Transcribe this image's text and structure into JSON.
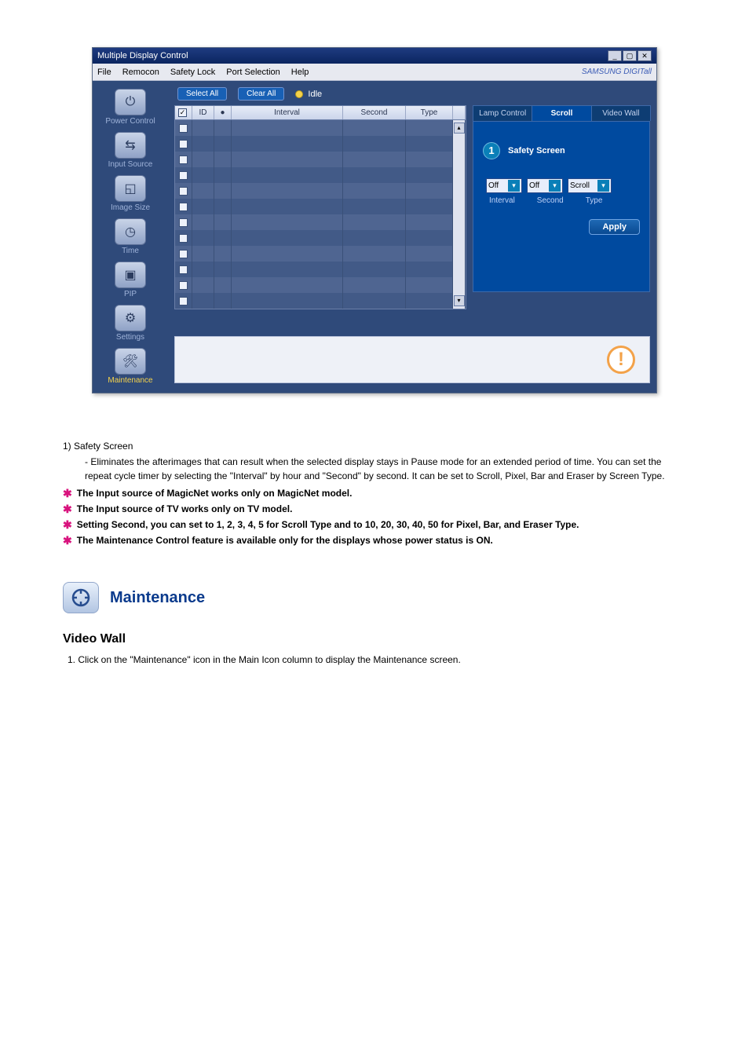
{
  "window": {
    "title": "Multiple Display Control",
    "menus": [
      "File",
      "Remocon",
      "Safety Lock",
      "Port Selection",
      "Help"
    ],
    "branding": "SAMSUNG DIGITall"
  },
  "sidebar": {
    "items": [
      {
        "label": "Power Control"
      },
      {
        "label": "Input Source"
      },
      {
        "label": "Image Size"
      },
      {
        "label": "Time"
      },
      {
        "label": "PIP"
      },
      {
        "label": "Settings"
      },
      {
        "label": "Maintenance"
      }
    ]
  },
  "toolbar": {
    "select_all": "Select All",
    "clear_all": "Clear All",
    "idle": "Idle"
  },
  "table": {
    "headers": {
      "chk": "",
      "id": "ID",
      "l": "",
      "interval": "Interval",
      "second": "Second",
      "type": "Type"
    },
    "row_count": 12
  },
  "rpanel": {
    "tabs": [
      {
        "label": "Lamp Control",
        "active": false
      },
      {
        "label": "Scroll",
        "active": true
      },
      {
        "label": "Video Wall",
        "active": false
      }
    ],
    "badge": "1",
    "section_title": "Safety Screen",
    "dd_interval": "Off",
    "dd_second": "Off",
    "dd_type": "Scroll",
    "lbl_interval": "Interval",
    "lbl_second": "Second",
    "lbl_type": "Type",
    "apply": "Apply"
  },
  "doc": {
    "point1_title": "1)  Safety Screen",
    "point1_sub": "- Eliminates the afterimages that can result when the selected display stays in Pause mode for an extended period of time. You can set the repeat cycle timer by selecting the \"Interval\" by hour and \"Second\" by second. It can be set to Scroll, Pixel, Bar and Eraser by Screen Type.",
    "stars": [
      "The Input source of MagicNet works only on MagicNet model.",
      "The Input source of TV works only on TV model.",
      "Setting Second, you can set to 1, 2, 3, 4, 5 for Scroll Type and to 10, 20, 30, 40, 50 for Pixel, Bar, and Eraser Type.",
      "The Maintenance Control feature is available only for the displays whose power status is ON."
    ],
    "section_title": "Maintenance",
    "h3": "Video Wall",
    "step1": "1.  Click on the \"Maintenance\" icon in the Main Icon column to display the Maintenance screen."
  }
}
